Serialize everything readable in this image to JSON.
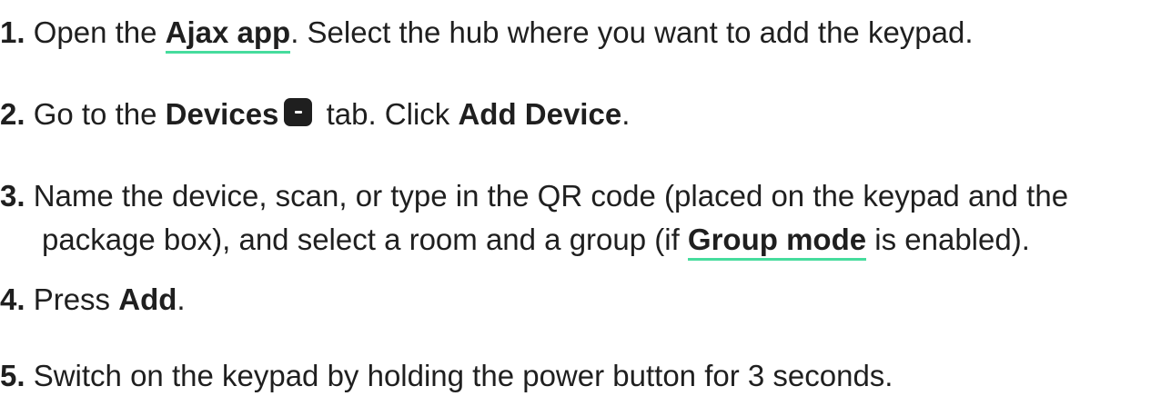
{
  "steps": [
    {
      "num": "1.",
      "text_a": "Open the ",
      "link": "Ajax app",
      "text_b": ". Select the hub where you want to add the keypad."
    },
    {
      "num": "2.",
      "text_a": "Go to the ",
      "bold_a": "Devices",
      "icon": "devices-tab-icon",
      "text_b": " tab. Click ",
      "bold_b": "Add Device",
      "text_c": "."
    },
    {
      "num": "3.",
      "line1": "Name the device, scan, or type in the QR code (placed on the keypad and the",
      "text_a": "package box), and select a room and a group (if ",
      "link": "Group mode",
      "text_b": " is enabled)."
    },
    {
      "num": "4.",
      "text_a": "Press ",
      "bold_a": "Add",
      "text_b": "."
    },
    {
      "num": "5.",
      "text_a": "Switch on the keypad by holding the power button for 3 seconds."
    }
  ],
  "colors": {
    "text": "#1f1f1f",
    "link_underline": "#46dc9d"
  }
}
